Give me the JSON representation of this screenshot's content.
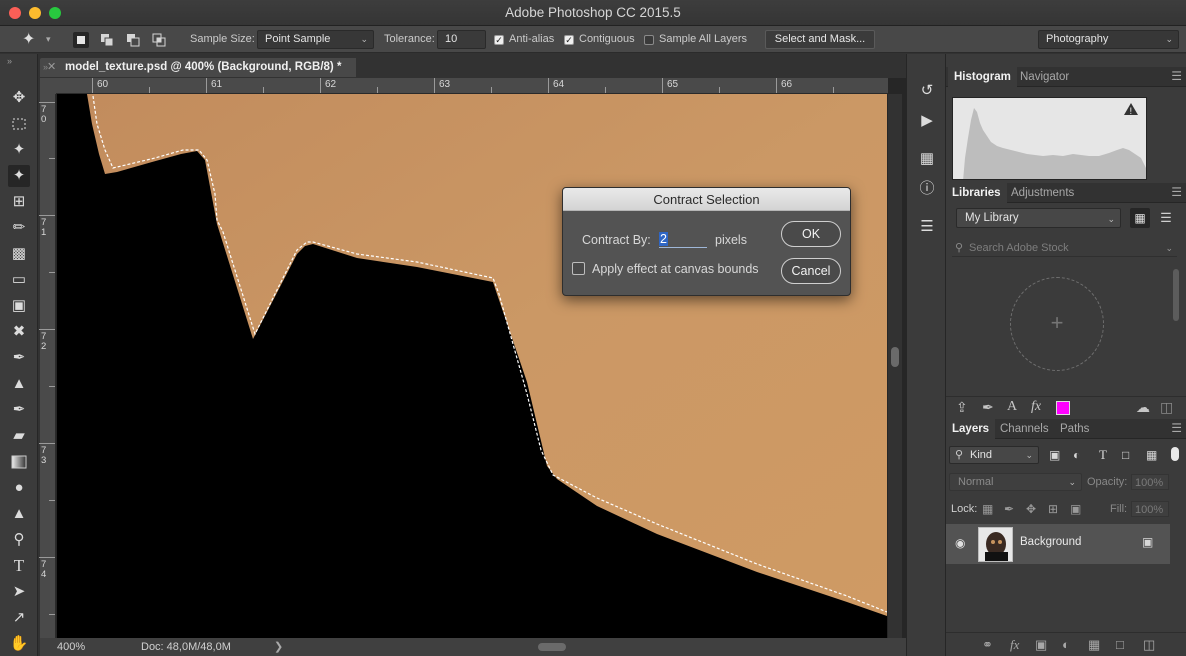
{
  "window": {
    "title": "Adobe Photoshop CC 2015.5"
  },
  "options": {
    "sample_size_label": "Sample Size:",
    "sample_size_value": "Point Sample",
    "tolerance_label": "Tolerance:",
    "tolerance_value": "10",
    "anti_alias_label": "Anti-alias",
    "contiguous_label": "Contiguous",
    "sample_all_label": "Sample All Layers",
    "select_mask_label": "Select and Mask...",
    "workspace_value": "Photography"
  },
  "document": {
    "tab_title": "model_texture.psd @ 400% (Background, RGB/8) *",
    "ruler_top": [
      "60",
      "61",
      "62",
      "63",
      "64",
      "65",
      "66"
    ],
    "ruler_left": [
      "7\n0",
      "7\n1",
      "7\n2",
      "7\n3",
      "7\n4"
    ],
    "status_zoom": "400%",
    "status_doc": "Doc: 48,0M/48,0M"
  },
  "dialog": {
    "title": "Contract Selection",
    "contract_label": "Contract By:",
    "contract_value": "2",
    "unit": "pixels",
    "checkbox_label": "Apply effect at canvas bounds",
    "ok": "OK",
    "cancel": "Cancel"
  },
  "panels": {
    "histogram_tab": "Histogram",
    "navigator_tab": "Navigator",
    "libraries_tab": "Libraries",
    "adjustments_tab": "Adjustments",
    "library_value": "My Library",
    "search_placeholder": "Search Adobe Stock",
    "layers_tab": "Layers",
    "channels_tab": "Channels",
    "paths_tab": "Paths",
    "kind_value": "Kind",
    "blend_value": "Normal",
    "opacity_label": "Opacity:",
    "opacity_value": "100%",
    "lock_label": "Lock:",
    "fill_label": "Fill:",
    "fill_value": "100%",
    "layer_name": "Background"
  },
  "colors": {
    "skin": "#c8945e",
    "swatch": "#ff00ff",
    "highlight": "#2f66c4"
  }
}
